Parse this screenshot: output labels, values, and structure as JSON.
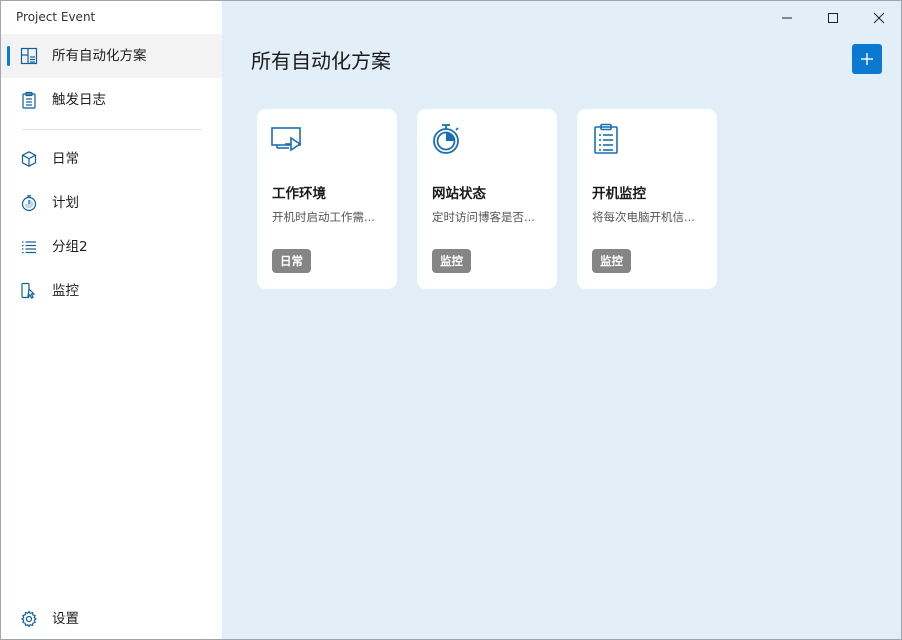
{
  "window": {
    "app_title": "Project Event"
  },
  "sidebar": {
    "items": [
      {
        "label": "所有自动化方案",
        "icon": "dashboard-icon",
        "active": true
      },
      {
        "label": "触发日志",
        "icon": "clipboard-icon",
        "active": false
      },
      {
        "label": "日常",
        "icon": "cube-icon",
        "active": false
      },
      {
        "label": "计划",
        "icon": "timer-icon",
        "active": false
      },
      {
        "label": "分组2",
        "icon": "list-icon",
        "active": false
      },
      {
        "label": "监控",
        "icon": "monitor-pointer-icon",
        "active": false
      }
    ],
    "settings_label": "设置"
  },
  "main": {
    "title": "所有自动化方案",
    "add_button": "+",
    "cards": [
      {
        "title": "工作环境",
        "desc": "开机时启动工作需...",
        "tag": "日常",
        "icon": "monitor-arrow-icon"
      },
      {
        "title": "网站状态",
        "desc": "定时访问博客是否...",
        "tag": "监控",
        "icon": "timer-icon"
      },
      {
        "title": "开机监控",
        "desc": "将每次电脑开机信...",
        "tag": "监控",
        "icon": "clipboard-list-icon"
      }
    ]
  },
  "colors": {
    "accent": "#0b78d1",
    "main_bg": "#e2eef8",
    "tag_bg": "#858585"
  }
}
